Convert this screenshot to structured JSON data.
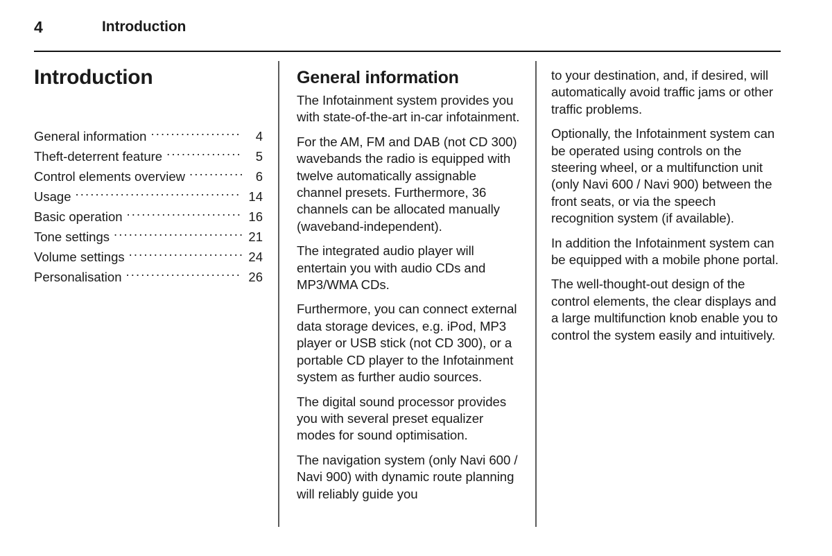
{
  "header": {
    "page_number": "4",
    "title": "Introduction"
  },
  "left_column": {
    "chapter_title": "Introduction",
    "toc": [
      {
        "label": "General information",
        "page": "4"
      },
      {
        "label": "Theft-deterrent feature",
        "page": "5"
      },
      {
        "label": "Control elements overview",
        "page": "6"
      },
      {
        "label": "Usage",
        "page": "14"
      },
      {
        "label": "Basic operation",
        "page": "16"
      },
      {
        "label": "Tone settings",
        "page": "21"
      },
      {
        "label": "Volume settings",
        "page": "24"
      },
      {
        "label": "Personalisation",
        "page": "26"
      }
    ]
  },
  "middle_column": {
    "section_heading": "General information",
    "paragraphs": [
      "The Infotainment system provides you with state-of-the-art in-car infotainment.",
      "For the AM, FM and DAB (not CD 300) wavebands the radio is equipped with twelve automatically assignable channel presets. Furthermore, 36 channels can be allocated manually (waveband-independent).",
      "The integrated audio player will entertain you with audio CDs and MP3/WMA CDs.",
      "Furthermore, you can connect external data storage devices, e.g. iPod, MP3 player or USB stick (not CD 300), or a portable CD player to the Infotainment system as further audio sources.",
      "The digital sound processor provides you with several preset equalizer modes for sound optimisation.",
      "The navigation system (only Navi 600 / Navi 900) with dynamic route planning will reliably guide you"
    ]
  },
  "right_column": {
    "paragraphs": [
      "to your destination, and, if desired, will automatically avoid traffic jams or other traffic problems.",
      "Optionally, the Infotainment system can be operated using controls on the steering wheel, or a multifunction unit (only Navi 600 / Navi 900) between the front seats, or via the speech recognition system (if available).",
      "In addition the Infotainment system can be equipped with a mobile phone portal.",
      "The well-thought-out design of the control elements, the clear displays and a large multifunction knob enable you to control the system easily and intuitively."
    ]
  },
  "colors": {
    "text": "#1a1a1a",
    "rule": "#141414",
    "divider": "#5b5b5b",
    "background": "#ffffff"
  }
}
